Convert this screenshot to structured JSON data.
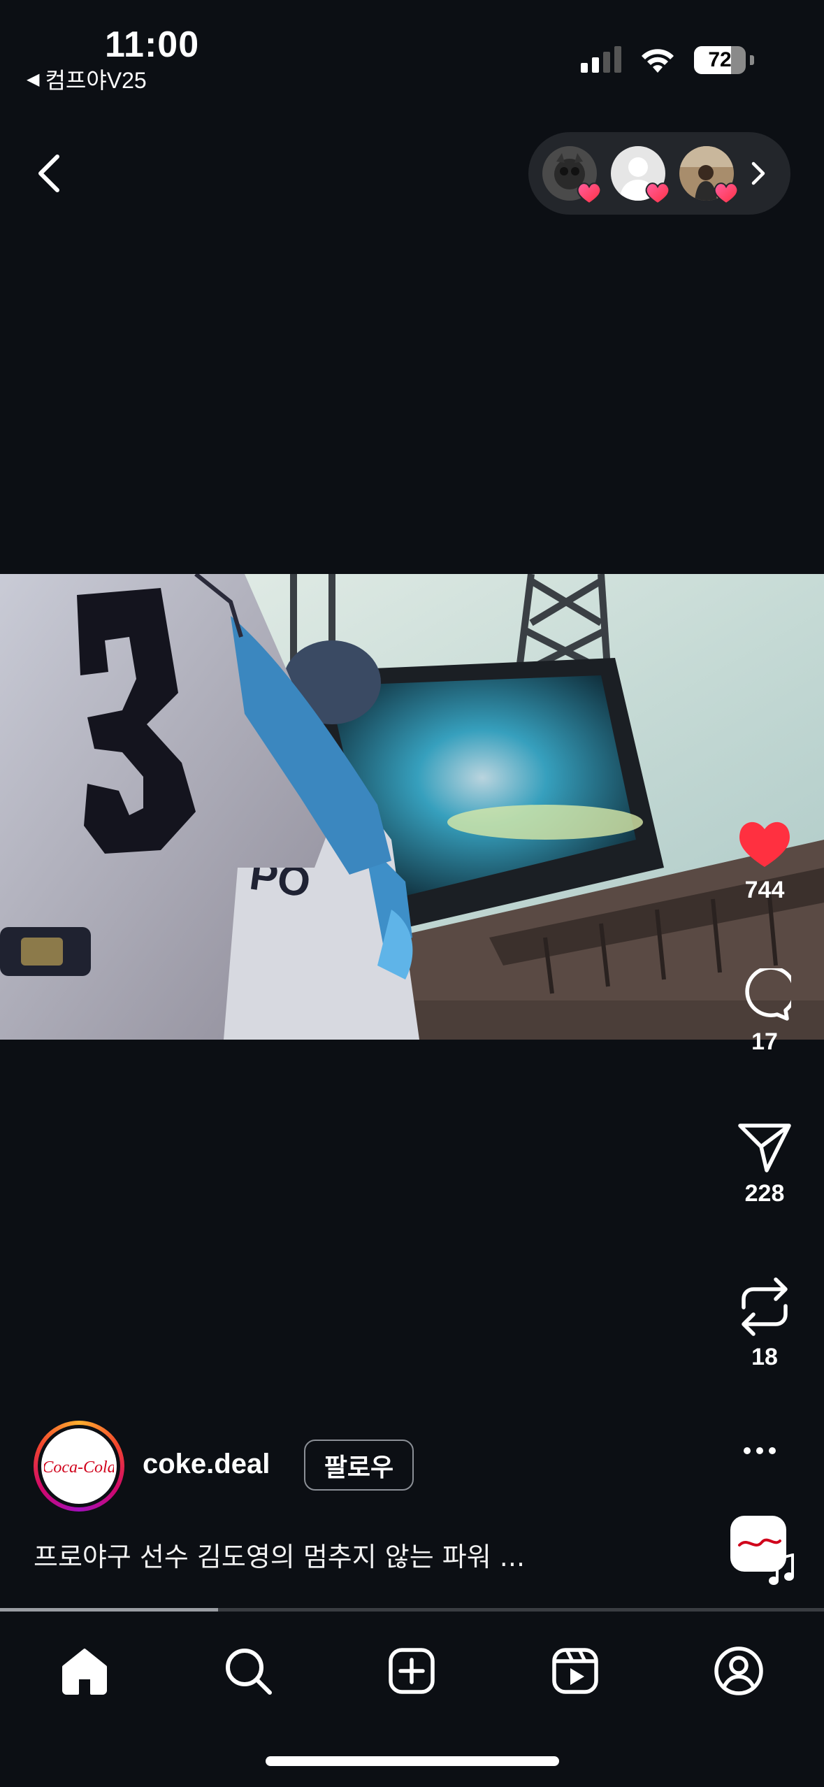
{
  "status_bar": {
    "time": "11:00",
    "back_app": "컴프야V25",
    "battery": "72",
    "battery_level": 0.72
  },
  "top_nav": {
    "back_icon": "chevron-left-icon",
    "friends_likes_icons": [
      "friend-avatar",
      "friend-avatar",
      "friend-avatar"
    ],
    "more_icon": "chevron-right-icon"
  },
  "actions": {
    "like_count": "744",
    "comment_count": "17",
    "share_count": "228",
    "repost_count": "18",
    "like_color": "#ff3040"
  },
  "post": {
    "username": "coke.deal",
    "follow_label": "팔로우",
    "caption": "프로야구 선수 김도영의 멈추지 않는 파워 ...",
    "avatar_logo_text": "Coca-Cola",
    "progress": 0.265
  },
  "tabbar": {
    "items": [
      "home-icon",
      "search-icon",
      "create-icon",
      "reels-icon",
      "profile-icon"
    ]
  }
}
